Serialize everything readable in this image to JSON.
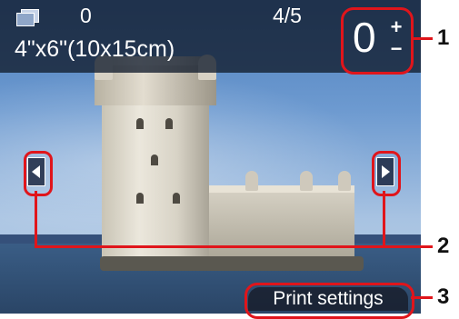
{
  "top_bar": {
    "copies_total": "0",
    "page_indicator": "4/5",
    "paper_size": "4\"x6\"(10x15cm)"
  },
  "copies": {
    "value": "0",
    "plus_glyph": "+",
    "minus_glyph": "−"
  },
  "scroll": {
    "left_icon": "scroll-left-icon",
    "right_icon": "scroll-right-icon"
  },
  "print_settings": {
    "label": "Print settings"
  },
  "callouts": {
    "one": "1",
    "two": "2",
    "three": "3",
    "color": "#e0151b"
  }
}
